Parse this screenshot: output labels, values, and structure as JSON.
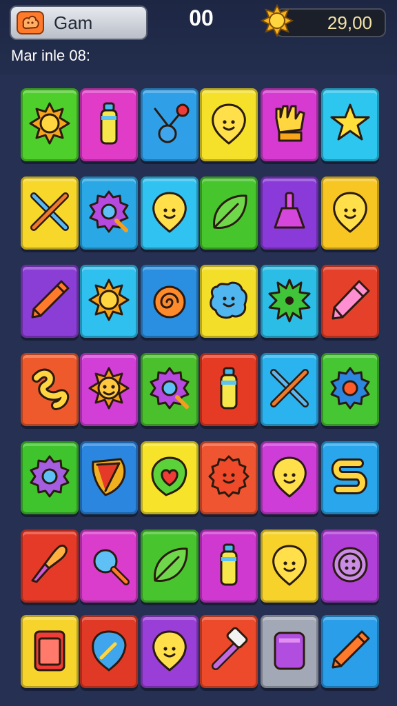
{
  "header": {
    "game_label": "Gam",
    "score": "00",
    "coins": "29,00",
    "subtitle": "Mar inle 08:"
  },
  "board": {
    "rows": 7,
    "cols": 6,
    "tiles": [
      {
        "color": "#4fcf2b",
        "icon": "sun-icon"
      },
      {
        "color": "#e03cc8",
        "icon": "bottle-icon"
      },
      {
        "color": "#2f9fe8",
        "icon": "joystick-icon"
      },
      {
        "color": "#f6e12a",
        "icon": "balloon-face-icon"
      },
      {
        "color": "#d63ad0",
        "icon": "glove-icon"
      },
      {
        "color": "#2cc6ef",
        "icon": "star-icon"
      },
      {
        "color": "#f6d72a",
        "icon": "crossed-tools-icon"
      },
      {
        "color": "#2aa8e6",
        "icon": "gear-magnifier-icon"
      },
      {
        "color": "#30c2f0",
        "icon": "balloon-face-icon"
      },
      {
        "color": "#47c52c",
        "icon": "leaf-icon"
      },
      {
        "color": "#8a3ad8",
        "icon": "flask-icon"
      },
      {
        "color": "#f7c623",
        "icon": "balloon-face-icon"
      },
      {
        "color": "#8b3ed6",
        "icon": "pencil-icon"
      },
      {
        "color": "#2fc0ef",
        "icon": "sun-icon"
      },
      {
        "color": "#2a8fe0",
        "icon": "spiral-icon"
      },
      {
        "color": "#f3df2a",
        "icon": "blob-face-icon"
      },
      {
        "color": "#2cbde6",
        "icon": "splat-icon"
      },
      {
        "color": "#e5402a",
        "icon": "crayon-icon"
      },
      {
        "color": "#ef5a2c",
        "icon": "squiggle-icon"
      },
      {
        "color": "#d23fd6",
        "icon": "sun-face-icon"
      },
      {
        "color": "#4ac12c",
        "icon": "gear-magnifier-icon"
      },
      {
        "color": "#e53b25",
        "icon": "bottle-icon"
      },
      {
        "color": "#2ab3ee",
        "icon": "crossed-tools-icon"
      },
      {
        "color": "#47c633",
        "icon": "gear-icon"
      },
      {
        "color": "#3fc42d",
        "icon": "gear-splat-icon"
      },
      {
        "color": "#2a86de",
        "icon": "shield-icon"
      },
      {
        "color": "#f7e32a",
        "icon": "heart-icon"
      },
      {
        "color": "#ef5530",
        "icon": "flower-face-icon"
      },
      {
        "color": "#cf3dd8",
        "icon": "balloon-face-icon"
      },
      {
        "color": "#2aa6ec",
        "icon": "letter-s-icon"
      },
      {
        "color": "#e63a28",
        "icon": "brush-icon"
      },
      {
        "color": "#da3ccb",
        "icon": "magnifier-icon"
      },
      {
        "color": "#48c42f",
        "icon": "leaf-icon"
      },
      {
        "color": "#cf39d0",
        "icon": "bottle-icon"
      },
      {
        "color": "#f6d22a",
        "icon": "balloon-face-icon"
      },
      {
        "color": "#b140d8",
        "icon": "button-icon"
      },
      {
        "color": "#f6d42b",
        "icon": "phone-icon"
      },
      {
        "color": "#e03a26",
        "icon": "guitar-pick-icon"
      },
      {
        "color": "#9a3ed8",
        "icon": "balloon-face-icon"
      },
      {
        "color": "#ec4a2a",
        "icon": "hammer-icon"
      },
      {
        "color": "#a3a8b6",
        "icon": "cup-icon"
      },
      {
        "color": "#2a9ee8",
        "icon": "pencil-icon"
      }
    ]
  }
}
